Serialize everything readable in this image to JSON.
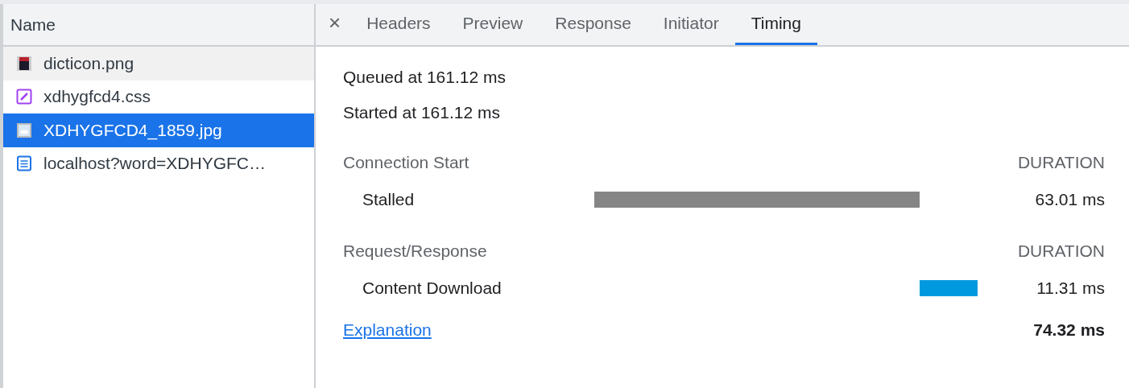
{
  "requests": {
    "column": "Name",
    "items": [
      {
        "name": "dicticon.png",
        "kind": "png",
        "hovered": true,
        "selected": false
      },
      {
        "name": "xdhygfcd4.css",
        "kind": "css",
        "hovered": false,
        "selected": false
      },
      {
        "name": "XDHYGFCD4_1859.jpg",
        "kind": "jpg",
        "hovered": false,
        "selected": true
      },
      {
        "name": "localhost?word=XDHYGFC…",
        "kind": "doc",
        "hovered": false,
        "selected": false
      }
    ]
  },
  "tabs": {
    "close": "×",
    "items": [
      {
        "label": "Headers",
        "selected": false
      },
      {
        "label": "Preview",
        "selected": false
      },
      {
        "label": "Response",
        "selected": false
      },
      {
        "label": "Initiator",
        "selected": false
      },
      {
        "label": "Timing",
        "selected": true
      }
    ]
  },
  "timing": {
    "queued": "Queued at 161.12 ms",
    "started": "Started at 161.12 ms",
    "sections": [
      {
        "title": "Connection Start",
        "duration_label": "DURATION",
        "phases": [
          {
            "name": "Stalled",
            "kind": "stalled",
            "duration": "63.01 ms"
          }
        ]
      },
      {
        "title": "Request/Response",
        "duration_label": "DURATION",
        "phases": [
          {
            "name": "Content Download",
            "kind": "download",
            "duration": "11.31 ms"
          }
        ]
      }
    ],
    "explanation": "Explanation",
    "total": "74.32 ms"
  }
}
